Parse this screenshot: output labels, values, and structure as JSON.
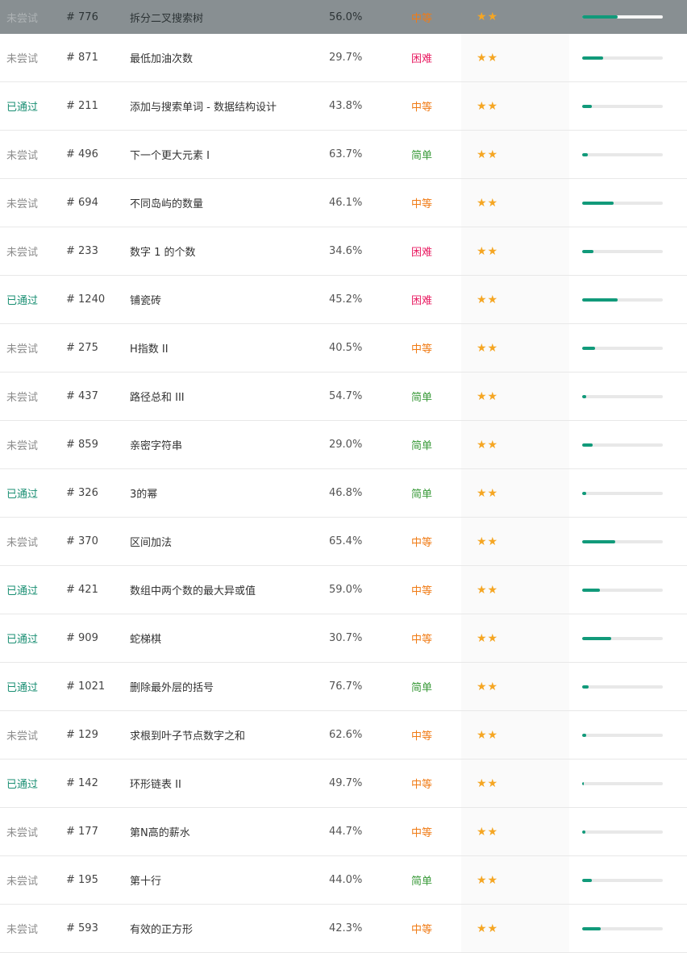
{
  "colors": {
    "passed": "#1a8f73",
    "untried": "#8c8c8c",
    "easy": "#3a9a3a",
    "medium": "#f07b15",
    "hard": "#e91e63",
    "star": "#f5a623",
    "bar_fill": "#119a7a",
    "bar_track": "#e8e8e8",
    "hover_row": "#888f92"
  },
  "icons": {
    "star": "star-icon"
  },
  "rows": [
    {
      "status": "未尝试",
      "status_type": "untried",
      "id": "# 776",
      "title": "拆分二叉搜索树",
      "rate": "56.0%",
      "difficulty": "中等",
      "diff_type": "medium",
      "stars": "★★",
      "progress": 0.44,
      "hover": true
    },
    {
      "status": "未尝试",
      "status_type": "untried",
      "id": "# 871",
      "title": "最低加油次数",
      "rate": "29.7%",
      "difficulty": "困难",
      "diff_type": "hard",
      "stars": "★★",
      "progress": 0.26
    },
    {
      "status": "已通过",
      "status_type": "passed",
      "id": "# 211",
      "title": "添加与搜索单词 - 数据结构设计",
      "rate": "43.8%",
      "difficulty": "中等",
      "diff_type": "medium",
      "stars": "★★",
      "progress": 0.12
    },
    {
      "status": "未尝试",
      "status_type": "untried",
      "id": "# 496",
      "title": "下一个更大元素 I",
      "rate": "63.7%",
      "difficulty": "简单",
      "diff_type": "easy",
      "stars": "★★",
      "progress": 0.07
    },
    {
      "status": "未尝试",
      "status_type": "untried",
      "id": "# 694",
      "title": "不同岛屿的数量",
      "rate": "46.1%",
      "difficulty": "中等",
      "diff_type": "medium",
      "stars": "★★",
      "progress": 0.39
    },
    {
      "status": "未尝试",
      "status_type": "untried",
      "id": "# 233",
      "title": "数字 1 的个数",
      "rate": "34.6%",
      "difficulty": "困难",
      "diff_type": "hard",
      "stars": "★★",
      "progress": 0.14
    },
    {
      "status": "已通过",
      "status_type": "passed",
      "id": "# 1240",
      "title": "铺瓷砖",
      "rate": "45.2%",
      "difficulty": "困难",
      "diff_type": "hard",
      "stars": "★★",
      "progress": 0.44
    },
    {
      "status": "未尝试",
      "status_type": "untried",
      "id": "# 275",
      "title": "H指数 II",
      "rate": "40.5%",
      "difficulty": "中等",
      "diff_type": "medium",
      "stars": "★★",
      "progress": 0.16
    },
    {
      "status": "未尝试",
      "status_type": "untried",
      "id": "# 437",
      "title": "路径总和 III",
      "rate": "54.7%",
      "difficulty": "简单",
      "diff_type": "easy",
      "stars": "★★",
      "progress": 0.05
    },
    {
      "status": "未尝试",
      "status_type": "untried",
      "id": "# 859",
      "title": "亲密字符串",
      "rate": "29.0%",
      "difficulty": "简单",
      "diff_type": "easy",
      "stars": "★★",
      "progress": 0.13
    },
    {
      "status": "已通过",
      "status_type": "passed",
      "id": "# 326",
      "title": "3的幂",
      "rate": "46.8%",
      "difficulty": "简单",
      "diff_type": "easy",
      "stars": "★★",
      "progress": 0.05
    },
    {
      "status": "未尝试",
      "status_type": "untried",
      "id": "# 370",
      "title": "区间加法",
      "rate": "65.4%",
      "difficulty": "中等",
      "diff_type": "medium",
      "stars": "★★",
      "progress": 0.41
    },
    {
      "status": "已通过",
      "status_type": "passed",
      "id": "# 421",
      "title": "数组中两个数的最大异或值",
      "rate": "59.0%",
      "difficulty": "中等",
      "diff_type": "medium",
      "stars": "★★",
      "progress": 0.22
    },
    {
      "status": "已通过",
      "status_type": "passed",
      "id": "# 909",
      "title": "蛇梯棋",
      "rate": "30.7%",
      "difficulty": "中等",
      "diff_type": "medium",
      "stars": "★★",
      "progress": 0.36
    },
    {
      "status": "已通过",
      "status_type": "passed",
      "id": "# 1021",
      "title": "删除最外层的括号",
      "rate": "76.7%",
      "difficulty": "简单",
      "diff_type": "easy",
      "stars": "★★",
      "progress": 0.08
    },
    {
      "status": "未尝试",
      "status_type": "untried",
      "id": "# 129",
      "title": "求根到叶子节点数字之和",
      "rate": "62.6%",
      "difficulty": "中等",
      "diff_type": "medium",
      "stars": "★★",
      "progress": 0.05
    },
    {
      "status": "已通过",
      "status_type": "passed",
      "id": "# 142",
      "title": "环形链表 II",
      "rate": "49.7%",
      "difficulty": "中等",
      "diff_type": "medium",
      "stars": "★★",
      "progress": 0.02
    },
    {
      "status": "未尝试",
      "status_type": "untried",
      "id": "# 177",
      "title": "第N高的薪水",
      "rate": "44.7%",
      "difficulty": "中等",
      "diff_type": "medium",
      "stars": "★★",
      "progress": 0.04
    },
    {
      "status": "未尝试",
      "status_type": "untried",
      "id": "# 195",
      "title": "第十行",
      "rate": "44.0%",
      "difficulty": "简单",
      "diff_type": "easy",
      "stars": "★★",
      "progress": 0.12
    },
    {
      "status": "未尝试",
      "status_type": "untried",
      "id": "# 593",
      "title": "有效的正方形",
      "rate": "42.3%",
      "difficulty": "中等",
      "diff_type": "medium",
      "stars": "★★",
      "progress": 0.23
    }
  ]
}
